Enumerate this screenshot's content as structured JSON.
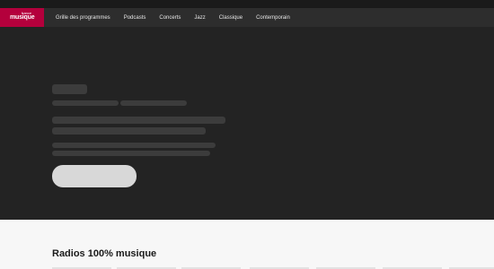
{
  "logo": {
    "small": "france",
    "big": "musique"
  },
  "nav": {
    "items": [
      "Grille des programmes",
      "Podcasts",
      "Concerts",
      "Jazz",
      "Classique",
      "Contemporain"
    ]
  },
  "section": {
    "title": "Radios 100% musique"
  },
  "colors": {
    "brand": "#b4003c",
    "nav_bg": "#2d2d2d",
    "hero_bg": "#232323",
    "skeleton": "#3c3c3c",
    "button_placeholder": "#d8d8d8",
    "content_bg": "#f7f7f7"
  }
}
